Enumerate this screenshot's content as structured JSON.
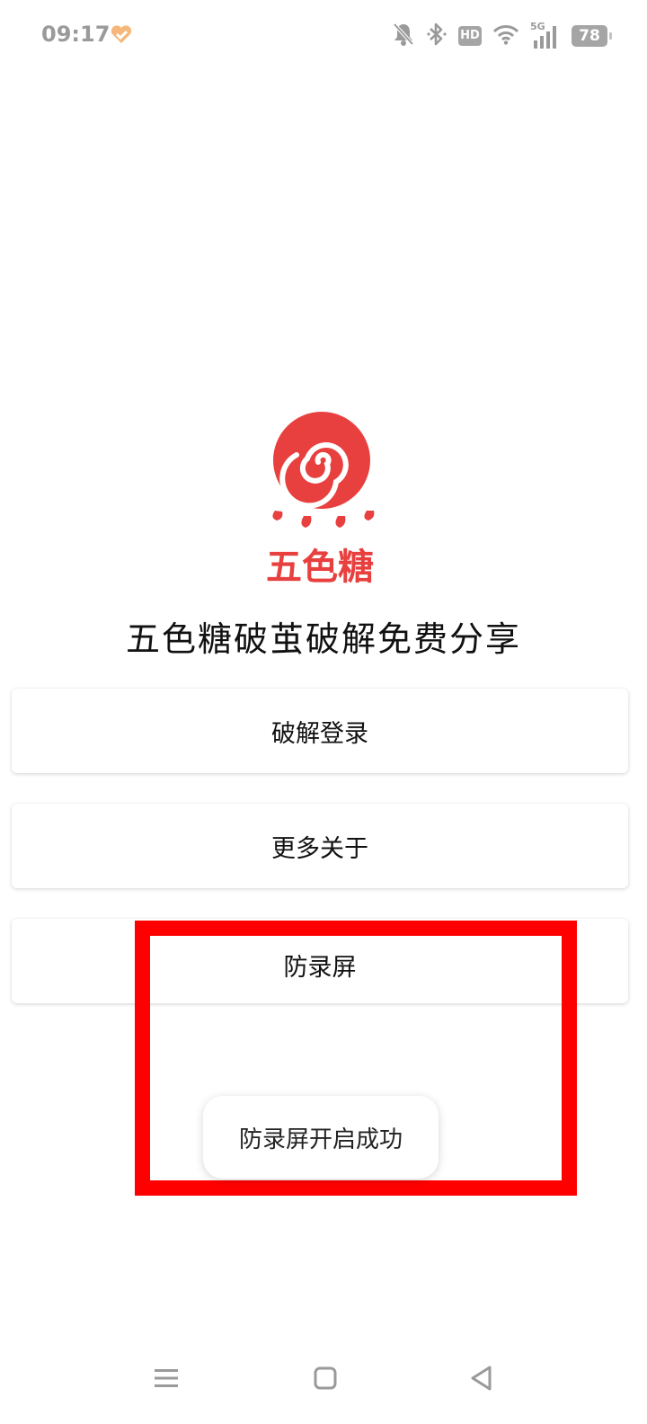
{
  "status_bar": {
    "time": "09:17",
    "hd": "HD",
    "network": "5G",
    "battery": "78",
    "icons": [
      "heart-app-icon",
      "mute-bell-icon",
      "bluetooth-icon",
      "hd-icon",
      "wifi-icon",
      "signal-icon",
      "battery-icon"
    ]
  },
  "logo": {
    "text": "五色糖",
    "color": "#e8403e"
  },
  "app": {
    "title": "五色糖破茧破解免费分享"
  },
  "buttons": {
    "crack_login": "破解登录",
    "more_about": "更多关于",
    "anti_record": "防录屏"
  },
  "toast": {
    "message": "防录屏开启成功"
  },
  "annotation": {
    "color": "#ff0000"
  },
  "nav_bar": {
    "icons": [
      "menu-icon",
      "home-icon",
      "back-icon"
    ]
  }
}
